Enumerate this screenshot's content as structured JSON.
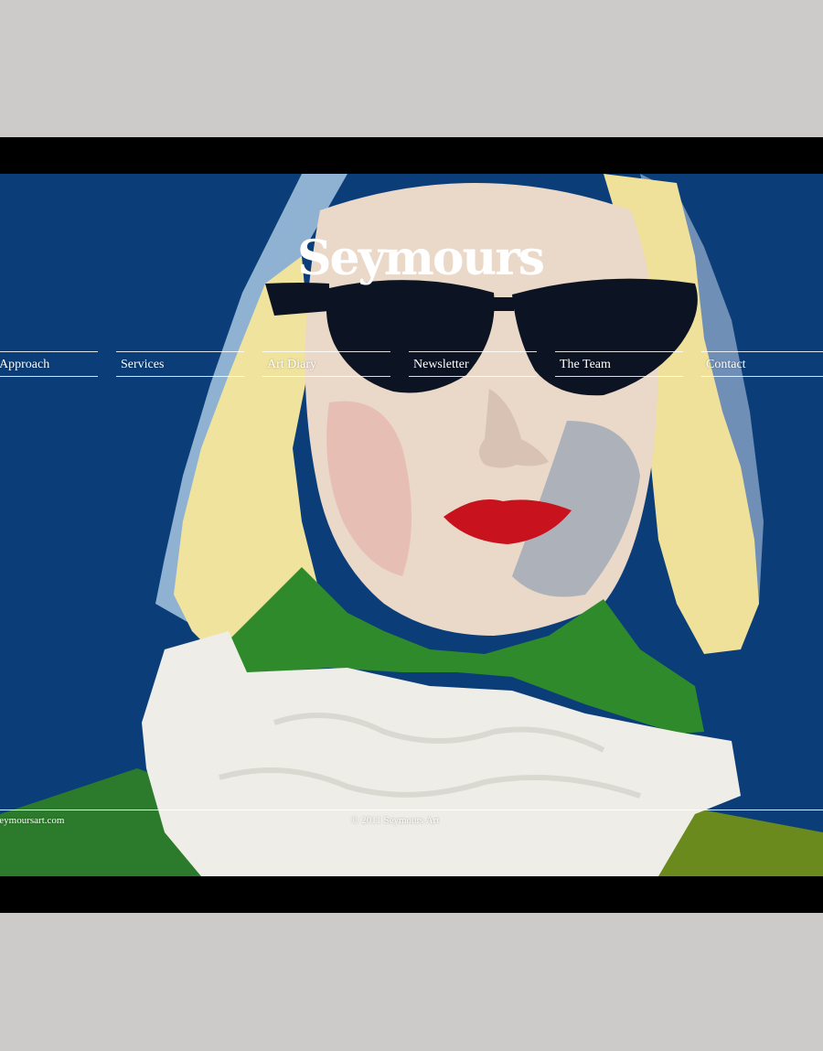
{
  "site": {
    "logo": "Seymours"
  },
  "nav": {
    "items": [
      {
        "label": "Approach"
      },
      {
        "label": "Services"
      },
      {
        "label": "Art Diary"
      },
      {
        "label": "Newsletter"
      },
      {
        "label": "The Team"
      },
      {
        "label": "Contact"
      }
    ]
  },
  "footer": {
    "domain": "seymoursart.com",
    "copyright": "© 2011 Seymours Art"
  },
  "colors": {
    "page_background": "#cccbc9",
    "screen_background": "#0b3e79",
    "bezel": "#000000",
    "text": "#ffffff"
  }
}
